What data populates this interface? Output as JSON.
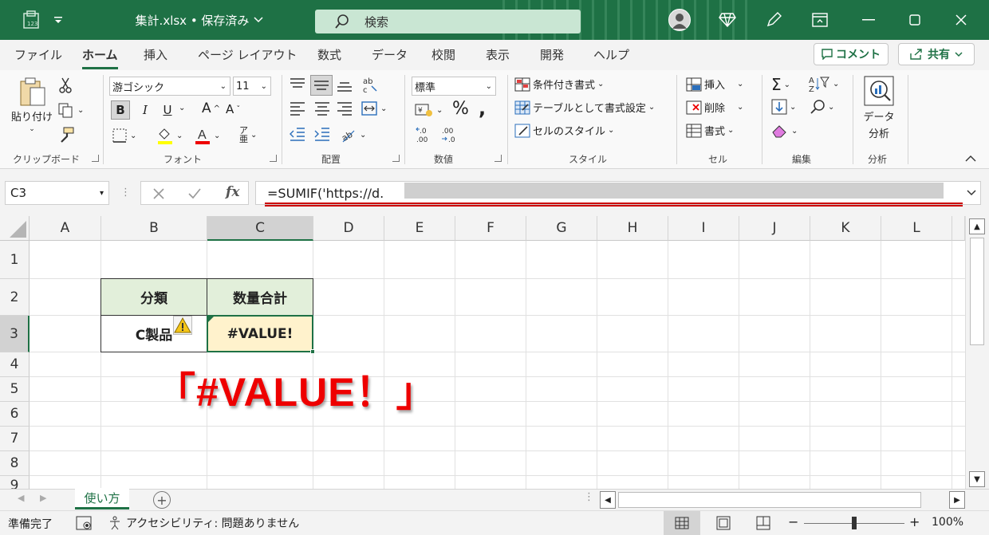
{
  "titlebar": {
    "filename": "集計.xlsx • 保存済み",
    "search": "検索"
  },
  "tabs": [
    "ファイル",
    "ホーム",
    "挿入",
    "ページ レイアウト",
    "数式",
    "データ",
    "校閲",
    "表示",
    "開発",
    "ヘルプ"
  ],
  "comment_label": "コメント",
  "share_label": "共有",
  "ribbon": {
    "clipboard": {
      "paste": "貼り付け",
      "label": "クリップボード"
    },
    "font": {
      "name": "游ゴシック",
      "size": "11",
      "label": "フォント",
      "bold": "B",
      "italic": "I",
      "underline": "U"
    },
    "align": {
      "label": "配置"
    },
    "number": {
      "format": "標準",
      "label": "数値"
    },
    "style": {
      "cond": "条件付き書式",
      "table": "テーブルとして書式設定",
      "cell": "セルのスタイル",
      "label": "スタイル"
    },
    "cells": {
      "insert": "挿入",
      "delete": "削除",
      "format": "書式",
      "label": "セル"
    },
    "edit": {
      "label": "編集"
    },
    "analysis": {
      "btn1": "データ",
      "btn2": "分析",
      "label": "分析"
    }
  },
  "formula_bar": {
    "name_box": "C3",
    "fx": "fx",
    "formula": "=SUMIF('https://d."
  },
  "columns": [
    "A",
    "B",
    "C",
    "D",
    "E",
    "F",
    "G",
    "H",
    "I",
    "J",
    "K",
    "L"
  ],
  "rows": [
    "1",
    "2",
    "3",
    "4",
    "5",
    "6",
    "7",
    "8",
    "9"
  ],
  "table": {
    "h1": "分類",
    "h2": "数量合計",
    "c1": "C製品",
    "c2": "#VALUE!"
  },
  "annotation": "「#VALUE！」",
  "sheet_tab": "使い方",
  "status": {
    "ready": "準備完了",
    "accessibility": "アクセシビリティ: 問題ありません",
    "zoom": "100%"
  },
  "colors": {
    "accent": "#1e7145",
    "error": "#e00000",
    "header_fill": "#e2efda",
    "error_fill": "#fff2cc"
  }
}
